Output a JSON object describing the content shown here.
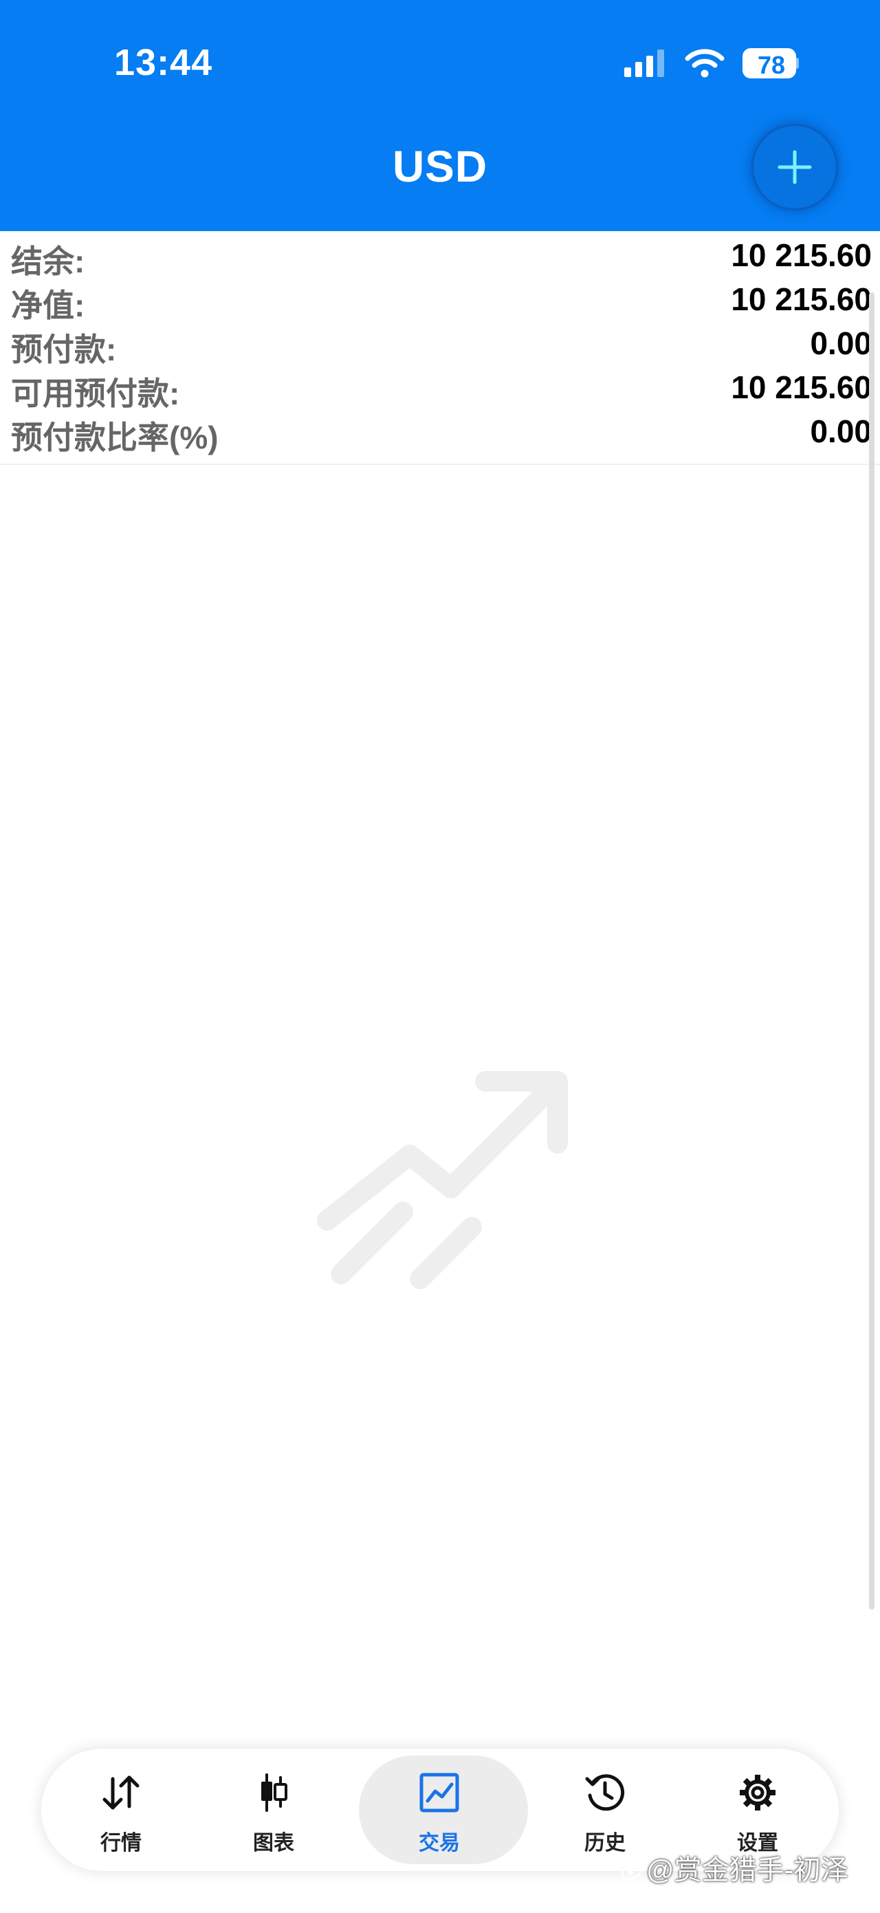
{
  "status_bar": {
    "time": "13:44",
    "battery_level": "78",
    "icons": [
      "cellular-signal-icon",
      "wifi-icon",
      "battery-icon"
    ]
  },
  "header": {
    "title": "USD",
    "add_icon": "plus-icon",
    "background_color": "#067df3"
  },
  "account_summary": [
    {
      "label": "结余:",
      "value": "10 215.60"
    },
    {
      "label": "净值:",
      "value": "10 215.60"
    },
    {
      "label": "预付款:",
      "value": "0.00"
    },
    {
      "label": "可用预付款:",
      "value": "10 215.60"
    },
    {
      "label": "预付款比率(%)",
      "value": "0.00"
    }
  ],
  "empty_state": {
    "icon": "trending-up-icon"
  },
  "tab_bar": {
    "active_tab": "交易",
    "active_color": "#1a73e8",
    "tabs": [
      {
        "label": "行情",
        "icon": "quotes-arrows-icon"
      },
      {
        "label": "图表",
        "icon": "candlestick-chart-icon"
      },
      {
        "label": "交易",
        "icon": "trade-chart-icon"
      },
      {
        "label": "历史",
        "icon": "history-icon"
      },
      {
        "label": "设置",
        "icon": "gear-icon"
      }
    ]
  },
  "watermark": {
    "text": "@赏金猎手-初泽",
    "logo": "weibo-logo-icon"
  }
}
